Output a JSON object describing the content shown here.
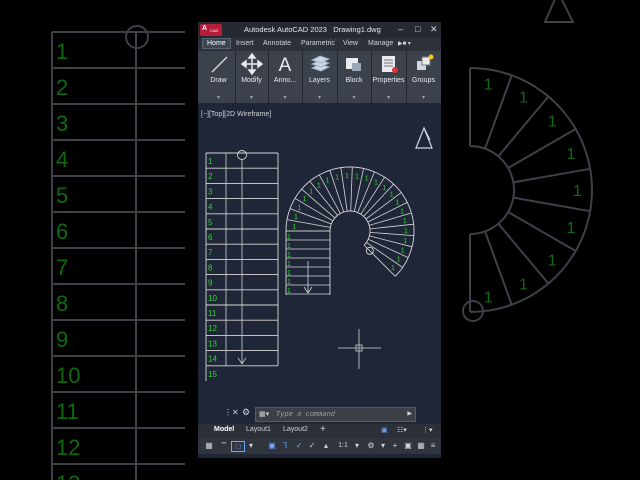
{
  "app": {
    "badge": "A",
    "badge_sub": "CAD",
    "title": "Autodesk AutoCAD 2023",
    "file": "Drawing1.dwg"
  },
  "ribbon_tabs": [
    "Home",
    "Insert",
    "Annotate",
    "Parametric",
    "View",
    "Manage"
  ],
  "ribbon_panels": [
    {
      "label": "Draw",
      "icon": "line-icon"
    },
    {
      "label": "Modify",
      "icon": "move-icon"
    },
    {
      "label": "Anno...",
      "icon": "text-icon"
    },
    {
      "label": "Layers",
      "icon": "layers-icon"
    },
    {
      "label": "Block",
      "icon": "block-icon"
    },
    {
      "label": "Properties",
      "icon": "properties-icon"
    },
    {
      "label": "Groups",
      "icon": "groups-icon"
    }
  ],
  "viewport": {
    "label": "[−][Top][2D Wireframe]",
    "straight_stair_numbers": [
      "1",
      "2",
      "3",
      "4",
      "5",
      "6",
      "7",
      "8",
      "9",
      "10",
      "11",
      "12",
      "13",
      "14",
      "15"
    ],
    "spiral_tread_label": "1"
  },
  "command": {
    "placeholder": "Type a command"
  },
  "layout_tabs": [
    "Model",
    "Layout1",
    "Layout2"
  ],
  "status": {
    "scale": "1:1"
  },
  "colors": {
    "accent_green": "#33d633",
    "drawing_lines": "#d6d6d6",
    "viewport_bg": "#1f2637",
    "badge_red": "#b71c3a"
  }
}
